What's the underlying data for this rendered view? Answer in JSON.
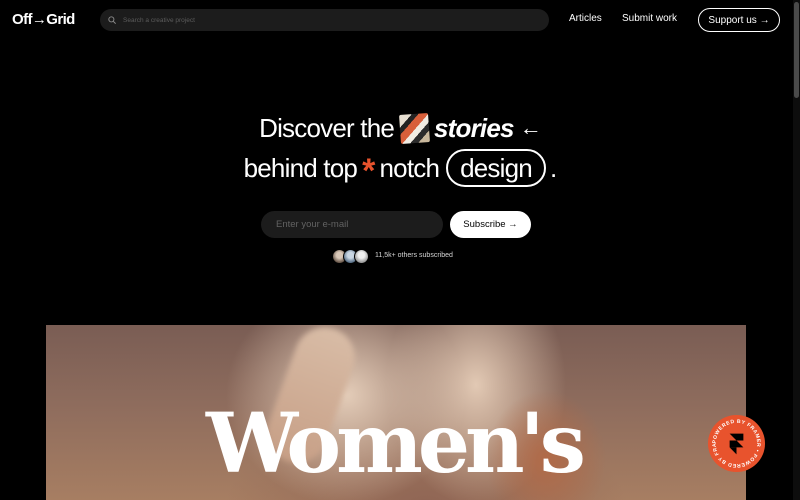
{
  "nav": {
    "logo": "Off→Grid",
    "search_placeholder": "Search a creative project",
    "links": [
      "Articles",
      "Submit work"
    ],
    "cta": "Support us →"
  },
  "hero": {
    "line1_before": "Discover the",
    "line1_italic": "stories",
    "line1_arrow": "←",
    "line2_before": "behind top",
    "asterisk": "*",
    "line2_mid": "notch",
    "pill_word": "design",
    "line2_end": "."
  },
  "subscribe": {
    "email_placeholder": "Enter your e-mail",
    "button": "Subscribe →",
    "social_proof": "11,5k+ others subscribed"
  },
  "feature": {
    "headline": "Women's"
  },
  "badge": {
    "text": "POWERED BY FRAMER • POWERED BY FRAMER •",
    "icon": "framer-icon"
  },
  "colors": {
    "background": "#000000",
    "accent": "#e8532d",
    "input_bg": "#1c1c1c"
  }
}
